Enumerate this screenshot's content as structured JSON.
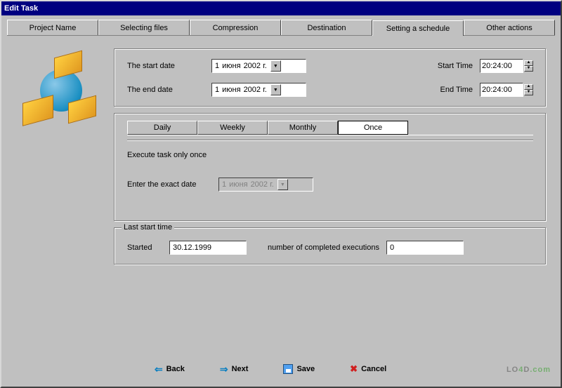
{
  "title": "Edit Task",
  "tabs": [
    "Project Name",
    "Selecting files",
    "Compression",
    "Destination",
    "Setting a schedule",
    "Other actions"
  ],
  "activeTab": 4,
  "schedule": {
    "startDateLabel": "The start date",
    "endDateLabel": "The end date",
    "startDateDay": "1",
    "startDateMonth": "июня",
    "startDateYear": "2002 г.",
    "endDateDay": "1",
    "endDateMonth": "июня",
    "endDateYear": "2002 г.",
    "startTimeLabel": "Start Time",
    "endTimeLabel": "End Time",
    "startTime": "20:24:00",
    "endTime": "20:24:00"
  },
  "freq": {
    "tabs": [
      "Daily",
      "Weekly",
      "Monthly",
      "Once"
    ],
    "active": 3,
    "onceText": "Execute task only once",
    "exactDateLabel": "Enter the exact date",
    "exactDay": "1",
    "exactMonth": "июня",
    "exactYear": "2002 г."
  },
  "lastStart": {
    "legend": "Last start time",
    "startedLabel": "Started",
    "startedValue": "30.12.1999",
    "execLabel": "number of completed executions",
    "execValue": "0"
  },
  "buttons": {
    "back": "Back",
    "next": "Next",
    "save": "Save",
    "cancel": "Cancel"
  },
  "watermark": {
    "lo": "LO",
    "four": "4",
    "d": "D",
    "dot": ".com"
  }
}
